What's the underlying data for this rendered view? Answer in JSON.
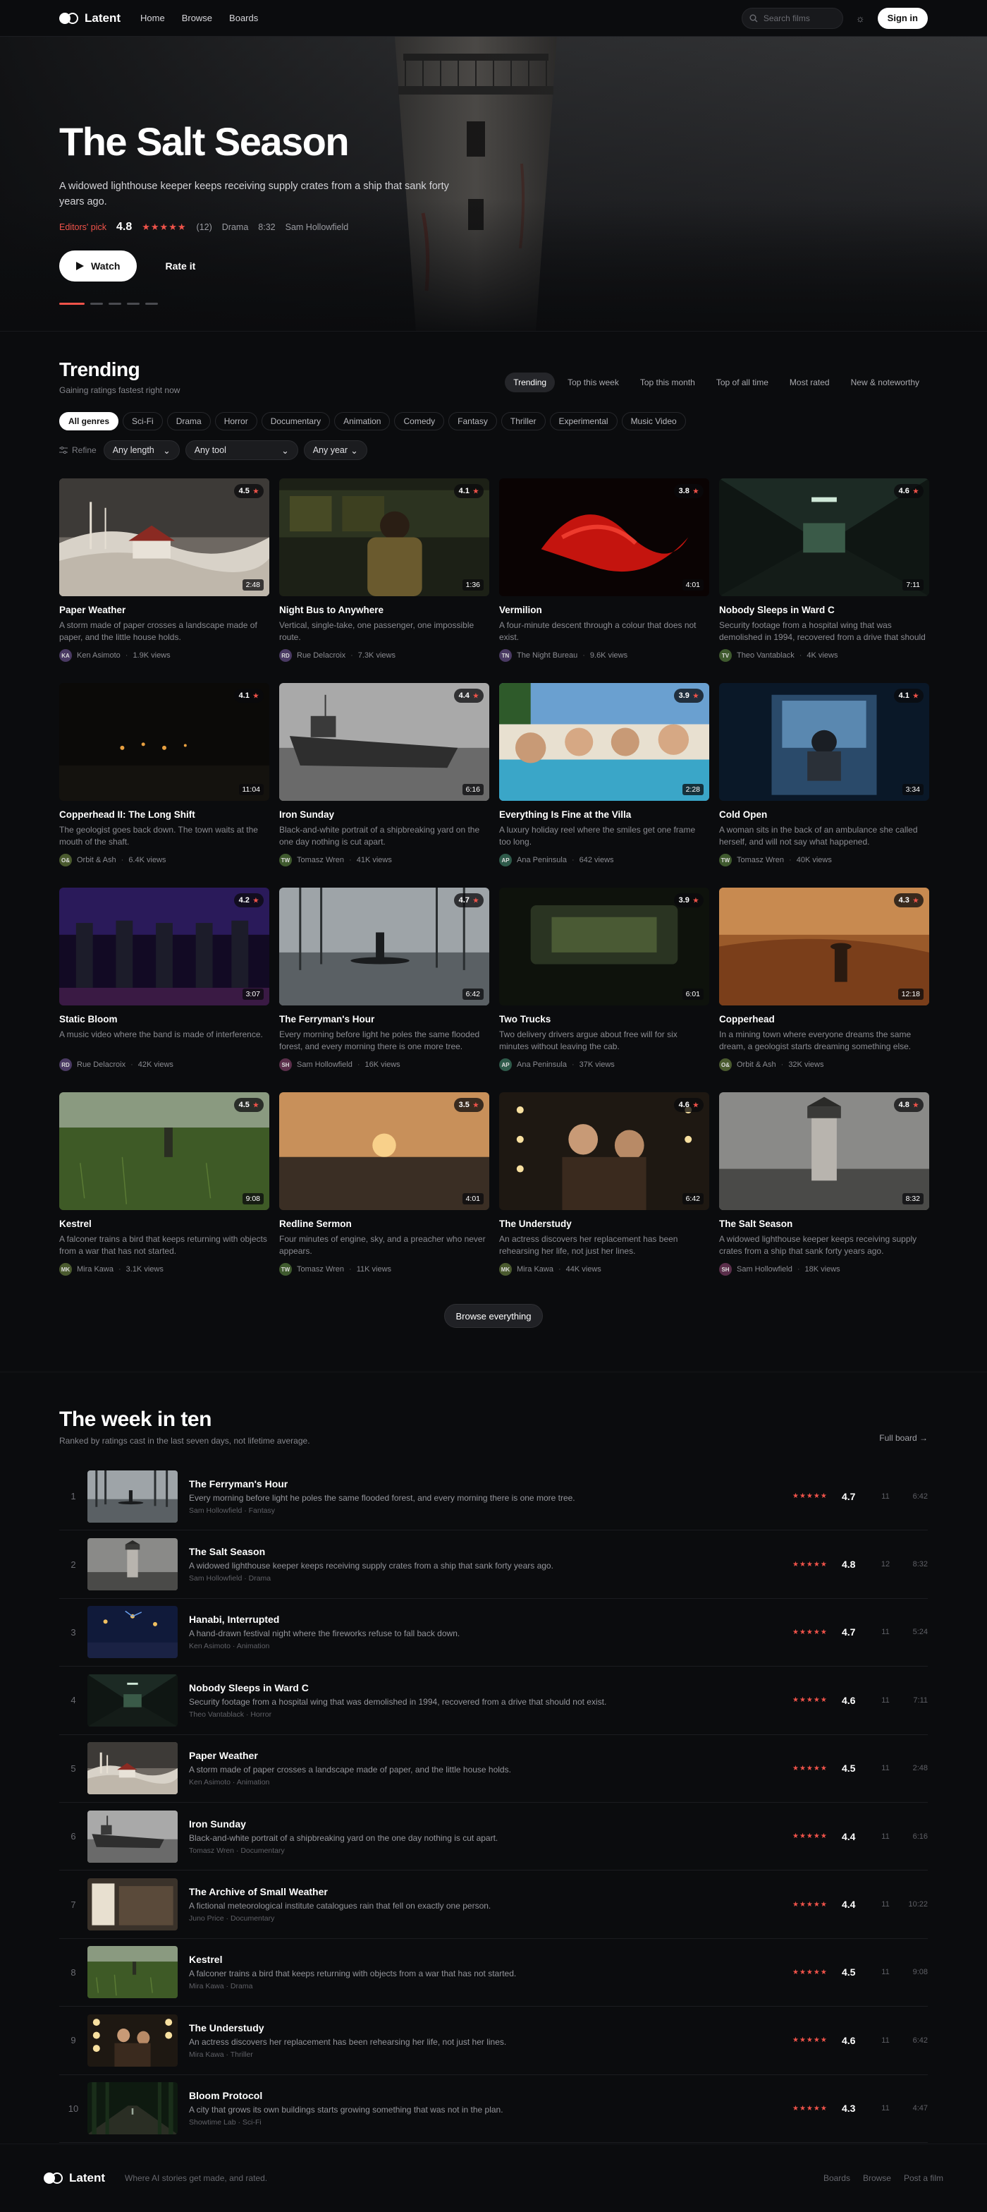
{
  "nav": {
    "brand": "Latent",
    "links": [
      "Home",
      "Browse",
      "Boards"
    ],
    "search_placeholder": "Search films",
    "signin": "Sign in"
  },
  "hero": {
    "title": "The Salt Season",
    "description": "A widowed lighthouse keeper keeps receiving supply crates from a ship that sank forty years ago.",
    "pick": "Editors' pick",
    "score": "4.8",
    "stars": "★★★★★",
    "count": "(12)",
    "genre": "Drama",
    "duration": "8:32",
    "creator": "Sam Hollowfield",
    "watch": "Watch",
    "rate": "Rate it",
    "slide_total": 5,
    "slide_active": 1
  },
  "trending": {
    "title": "Trending",
    "subtitle": "Gaining ratings fastest right now",
    "tabs": [
      "Trending",
      "Top this week",
      "Top this month",
      "Top of all time",
      "Most rated",
      "New & noteworthy"
    ],
    "genres": [
      "All genres",
      "Sci-Fi",
      "Drama",
      "Horror",
      "Documentary",
      "Animation",
      "Comedy",
      "Fantasy",
      "Thriller",
      "Experimental",
      "Music Video"
    ],
    "refine": "Refine",
    "filters": [
      "Any length",
      "Any tool",
      "Any year"
    ],
    "browse": "Browse everything"
  },
  "cards": [
    {
      "title": "Paper Weather",
      "desc": "A storm made of paper crosses a landscape made of paper, and the little house holds.",
      "rating": "4.5",
      "duration": "2:48",
      "initials": "KA",
      "avatar_color": "#4a3a63",
      "creator": "Ken Asimoto",
      "views": "1.9K views",
      "scene": "paper"
    },
    {
      "title": "Night Bus to Anywhere",
      "desc": "Vertical, single-take, one passenger, one impossible route.",
      "rating": "4.1",
      "duration": "1:36",
      "initials": "RD",
      "avatar_color": "#4a3a63",
      "creator": "Rue Delacroix",
      "views": "7.3K views",
      "scene": "bus"
    },
    {
      "title": "Vermilion",
      "desc": "A four-minute descent through a colour that does not exist.",
      "rating": "3.8",
      "duration": "4:01",
      "initials": "TN",
      "avatar_color": "#4a3a63",
      "creator": "The Night Bureau",
      "views": "9.6K views",
      "scene": "red"
    },
    {
      "title": "Nobody Sleeps in Ward C",
      "desc": "Security footage from a hospital wing that was demolished in 1994, recovered from a drive that should not exist.",
      "rating": "4.6",
      "duration": "7:11",
      "initials": "TV",
      "avatar_color": "#3f5a2e",
      "creator": "Theo Vantablack",
      "views": "4K views",
      "scene": "ward"
    },
    {
      "title": "Copperhead II: The Long Shift",
      "desc": "The geologist goes back down. The town waits at the mouth of the shaft.",
      "rating": "4.1",
      "duration": "11:04",
      "initials": "O&",
      "avatar_color": "#4a5a2e",
      "creator": "Orbit & Ash",
      "views": "6.4K views",
      "scene": "dark"
    },
    {
      "title": "Iron Sunday",
      "desc": "Black-and-white portrait of a shipbreaking yard on the one day nothing is cut apart.",
      "rating": "4.4",
      "duration": "6:16",
      "initials": "TW",
      "avatar_color": "#3f5a2e",
      "creator": "Tomasz Wren",
      "views": "41K views",
      "scene": "ship"
    },
    {
      "title": "Everything Is Fine at the Villa",
      "desc": "A luxury holiday reel where the smiles get one frame too long.",
      "rating": "3.9",
      "duration": "2:28",
      "initials": "AP",
      "avatar_color": "#2e5a4a",
      "creator": "Ana Peninsula",
      "views": "642 views",
      "scene": "villa"
    },
    {
      "title": "Cold Open",
      "desc": "A woman sits in the back of an ambulance she called herself, and will not say what happened.",
      "rating": "4.1",
      "duration": "3:34",
      "initials": "TW",
      "avatar_color": "#3f5a2e",
      "creator": "Tomasz Wren",
      "views": "40K views",
      "scene": "ambulance"
    },
    {
      "title": "Static Bloom",
      "desc": "A music video where the band is made of interference.",
      "rating": "4.2",
      "duration": "3:07",
      "initials": "RD",
      "avatar_color": "#4a3a63",
      "creator": "Rue Delacroix",
      "views": "42K views",
      "scene": "band"
    },
    {
      "title": "The Ferryman's Hour",
      "desc": "Every morning before light he poles the same flooded forest, and every morning there is one more tree.",
      "rating": "4.7",
      "duration": "6:42",
      "initials": "SH",
      "avatar_color": "#5a2e4a",
      "creator": "Sam Hollowfield",
      "views": "16K views",
      "scene": "ferry"
    },
    {
      "title": "Two Trucks",
      "desc": "Two delivery drivers argue about free will for six minutes without leaving the cab.",
      "rating": "3.9",
      "duration": "6:01",
      "initials": "AP",
      "avatar_color": "#2e5a4a",
      "creator": "Ana Peninsula",
      "views": "37K views",
      "scene": "truck"
    },
    {
      "title": "Copperhead",
      "desc": "In a mining town where everyone dreams the same dream, a geologist starts dreaming something else.",
      "rating": "4.3",
      "duration": "12:18",
      "initials": "O&",
      "avatar_color": "#4a5a2e",
      "creator": "Orbit & Ash",
      "views": "32K views",
      "scene": "desert"
    },
    {
      "title": "Kestrel",
      "desc": "A falconer trains a bird that keeps returning with objects from a war that has not started.",
      "rating": "4.5",
      "duration": "9:08",
      "initials": "MK",
      "avatar_color": "#4a5a2e",
      "creator": "Mira Kawa",
      "views": "3.1K views",
      "scene": "field"
    },
    {
      "title": "Redline Sermon",
      "desc": "Four minutes of engine, sky, and a preacher who never appears.",
      "rating": "3.5",
      "duration": "4:01",
      "initials": "TW",
      "avatar_color": "#3f5a2e",
      "creator": "Tomasz Wren",
      "views": "11K views",
      "scene": "sunset"
    },
    {
      "title": "The Understudy",
      "desc": "An actress discovers her replacement has been rehearsing her life, not just her lines.",
      "rating": "4.6",
      "duration": "6:42",
      "initials": "MK",
      "avatar_color": "#4a5a2e",
      "creator": "Mira Kawa",
      "views": "44K views",
      "scene": "mirror"
    },
    {
      "title": "The Salt Season",
      "desc": "A widowed lighthouse keeper keeps receiving supply crates from a ship that sank forty years ago.",
      "rating": "4.8",
      "duration": "8:32",
      "initials": "SH",
      "avatar_color": "#5a2e4a",
      "creator": "Sam Hollowfield",
      "views": "18K views",
      "scene": "lighthouse"
    }
  ],
  "week": {
    "title": "The week in ten",
    "subtitle": "Ranked by ratings cast in the last seven days, not lifetime average.",
    "full_board": "Full board →",
    "items": [
      {
        "rank": "1",
        "title": "The Ferryman's Hour",
        "desc": "Every morning before light he poles the same flooded forest, and every morning there is one more tree.",
        "meta": "Sam Hollowfield · Fantasy",
        "stars": "★★★★★",
        "score": "4.7",
        "count": "11",
        "duration": "6:42",
        "scene": "ferry"
      },
      {
        "rank": "2",
        "title": "The Salt Season",
        "desc": "A widowed lighthouse keeper keeps receiving supply crates from a ship that sank forty years ago.",
        "meta": "Sam Hollowfield · Drama",
        "stars": "★★★★★",
        "score": "4.8",
        "count": "12",
        "duration": "8:32",
        "scene": "lighthouse"
      },
      {
        "rank": "3",
        "title": "Hanabi, Interrupted",
        "desc": "A hand-drawn festival night where the fireworks refuse to fall back down.",
        "meta": "Ken Asimoto · Animation",
        "stars": "★★★★★",
        "score": "4.7",
        "count": "11",
        "duration": "5:24",
        "scene": "fireworks"
      },
      {
        "rank": "4",
        "title": "Nobody Sleeps in Ward C",
        "desc": "Security footage from a hospital wing that was demolished in 1994, recovered from a drive that should not exist.",
        "meta": "Theo Vantablack · Horror",
        "stars": "★★★★★",
        "score": "4.6",
        "count": "11",
        "duration": "7:11",
        "scene": "ward"
      },
      {
        "rank": "5",
        "title": "Paper Weather",
        "desc": "A storm made of paper crosses a landscape made of paper, and the little house holds.",
        "meta": "Ken Asimoto · Animation",
        "stars": "★★★★★",
        "score": "4.5",
        "count": "11",
        "duration": "2:48",
        "scene": "paper"
      },
      {
        "rank": "6",
        "title": "Iron Sunday",
        "desc": "Black-and-white portrait of a shipbreaking yard on the one day nothing is cut apart.",
        "meta": "Tomasz Wren · Documentary",
        "stars": "★★★★★",
        "score": "4.4",
        "count": "11",
        "duration": "6:16",
        "scene": "ship"
      },
      {
        "rank": "7",
        "title": "The Archive of Small Weather",
        "desc": "A fictional meteorological institute catalogues rain that fell on exactly one person.",
        "meta": "Juno Price · Documentary",
        "stars": "★★★★★",
        "score": "4.4",
        "count": "11",
        "duration": "10:22",
        "scene": "archive"
      },
      {
        "rank": "8",
        "title": "Kestrel",
        "desc": "A falconer trains a bird that keeps returning with objects from a war that has not started.",
        "meta": "Mira Kawa · Drama",
        "stars": "★★★★★",
        "score": "4.5",
        "count": "11",
        "duration": "9:08",
        "scene": "field"
      },
      {
        "rank": "9",
        "title": "The Understudy",
        "desc": "An actress discovers her replacement has been rehearsing her life, not just her lines.",
        "meta": "Mira Kawa · Thriller",
        "stars": "★★★★★",
        "score": "4.6",
        "count": "11",
        "duration": "6:42",
        "scene": "mirror"
      },
      {
        "rank": "10",
        "title": "Bloom Protocol",
        "desc": "A city that grows its own buildings starts growing something that was not in the plan.",
        "meta": "Showtime Lab · Sci-Fi",
        "stars": "★★★★★",
        "score": "4.3",
        "count": "11",
        "duration": "4:47",
        "scene": "forest"
      }
    ]
  },
  "footer": {
    "brand": "Latent",
    "tagline": "Where AI stories get made, and rated.",
    "links": [
      "Boards",
      "Browse",
      "Post a film"
    ]
  },
  "colors": {
    "accent": "#f0534a",
    "bg": "#0b0c0e"
  }
}
